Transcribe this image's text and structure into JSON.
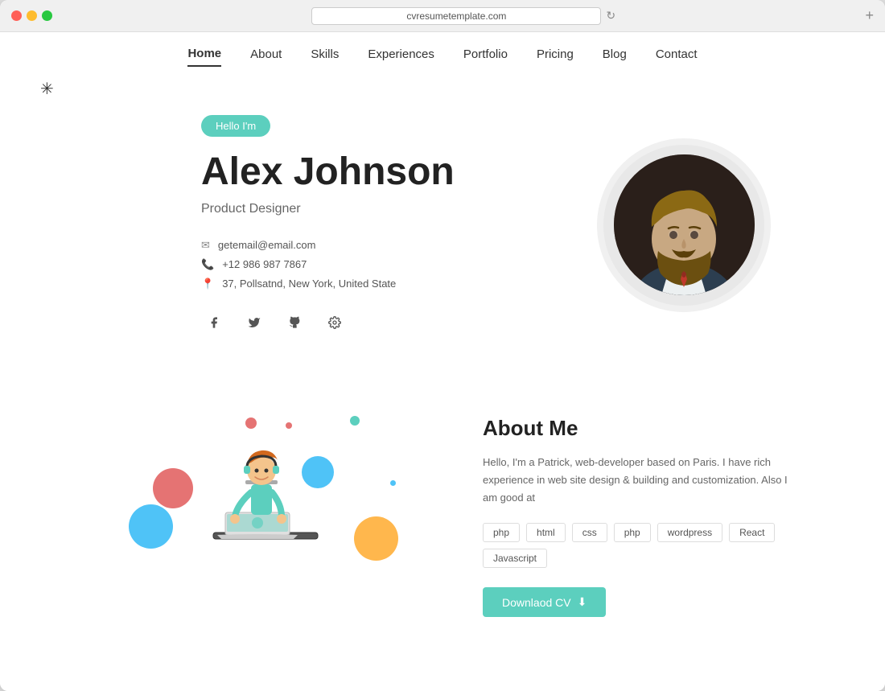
{
  "browser": {
    "url": "cvresumetemplate.com"
  },
  "nav": {
    "items": [
      {
        "label": "Home",
        "active": true
      },
      {
        "label": "About",
        "active": false
      },
      {
        "label": "Skills",
        "active": false
      },
      {
        "label": "Experiences",
        "active": false
      },
      {
        "label": "Portfolio",
        "active": false
      },
      {
        "label": "Pricing",
        "active": false
      },
      {
        "label": "Blog",
        "active": false
      },
      {
        "label": "Contact",
        "active": false
      }
    ]
  },
  "hero": {
    "badge": "Hello I'm",
    "name": "Alex Johnson",
    "title": "Product Designer",
    "email": "getemail@email.com",
    "phone": "+12 986 987 7867",
    "address": "37, Pollsatnd, New York, United State"
  },
  "about": {
    "title": "About Me",
    "text": "Hello, I'm a Patrick, web-developer based on Paris. I have rich experience in web site design & building and customization. Also I am good at",
    "skills": [
      "php",
      "html",
      "css",
      "php",
      "wordpress",
      "React",
      "Javascript"
    ],
    "download_label": "Downlaod CV"
  },
  "colors": {
    "accent": "#5ccfbe",
    "dark": "#222222",
    "text": "#555555",
    "light": "#e8e8e8"
  }
}
